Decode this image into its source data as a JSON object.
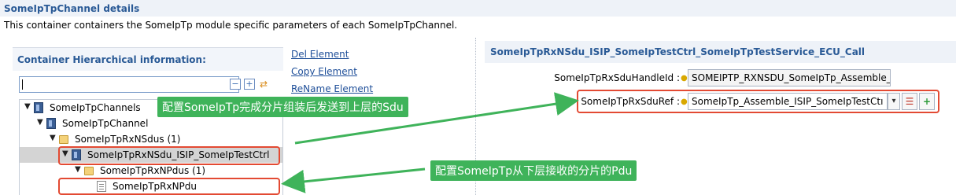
{
  "page": {
    "title": "SomeIpTpChannel details",
    "description": "This container containers the SomeIpTp module specific parameters of each SomeIpTpChannel."
  },
  "left": {
    "section_title": "Container Hierarchical information:",
    "filter_value": "",
    "toolbar_icons": [
      "collapse-all-icon",
      "expand-all-icon",
      "sync-icon"
    ],
    "tree": [
      {
        "label": "SomeIpTpChannels",
        "icon": "container-icon",
        "twisty": "▼"
      },
      {
        "label": "SomeIpTpChannel",
        "icon": "container-icon",
        "twisty": "▼"
      },
      {
        "label": "SomeIpTpRxNSdus (1)",
        "icon": "folder-icon",
        "twisty": "▼"
      },
      {
        "label": "SomeIpTpRxNSdu_ISIP_SomeIpTestCtrl",
        "icon": "container-icon",
        "twisty": "▼"
      },
      {
        "label": "SomeIpTpRxNPdus (1)",
        "icon": "folder-icon",
        "twisty": "▼"
      },
      {
        "label": "SomeIpTpRxNPdu",
        "icon": "document-icon",
        "twisty": ""
      }
    ]
  },
  "actions": {
    "del": "Del Element",
    "copy": "Copy Element",
    "rename": "ReName Element"
  },
  "right": {
    "title": "SomeIpTpRxNSdu_ISIP_SomeIpTestCtrl_SomeIpTpTestService_ECU_Call",
    "handle_label": "SomeIpTpRxSduHandleId :",
    "handle_value": "SOMEIPTP_RXNSDU_SomeIpTp_Assemble_I",
    "ref_label": "SomeIpTpRxSduRef :",
    "ref_value": "SomeIpTp_Assemble_ISIP_SomeIpTestCtı",
    "ref_dropdown": "▾",
    "ref_list_icon": "list-icon",
    "ref_add_icon": "add-icon"
  },
  "annotations": {
    "callout_top": "配置SomeIpTp完成分片组装后发送到上层的Sdu",
    "callout_bottom": "配置SomeIpTp从下层接收的分片的Pdu",
    "color": "#3fb35a",
    "highlight_color": "#e34a33"
  }
}
